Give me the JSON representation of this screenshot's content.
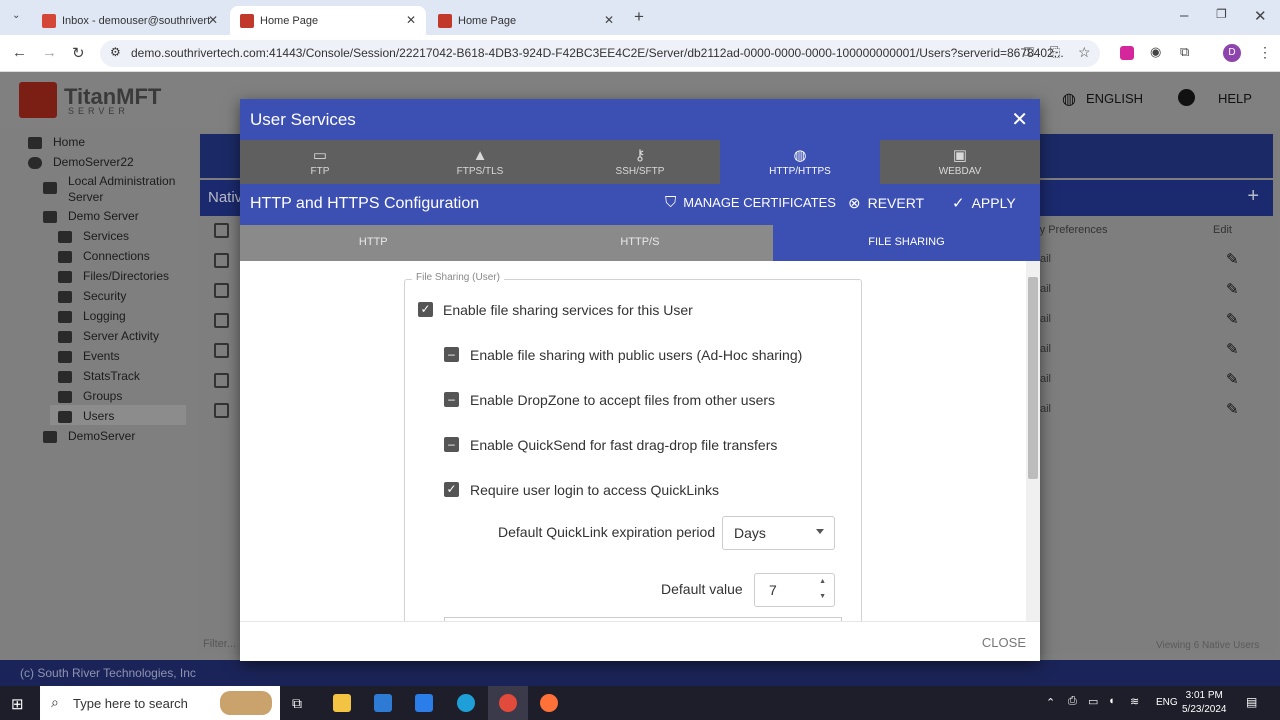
{
  "browser": {
    "tabs": [
      {
        "title": "Inbox - demouser@southrivert"
      },
      {
        "title": "Home Page"
      },
      {
        "title": "Home Page"
      }
    ],
    "url": "demo.southrivertech.com:41443/Console/Session/22217042-B618-4DB3-924D-F42BC3EE4C2E/Server/db2112ad-0000-0000-0000-100000000001/Users?serverid=8678402..."
  },
  "app": {
    "logo_text": "TitanMFT",
    "logo_sub": "SERVER",
    "language": "ENGLISH",
    "help": "HELP",
    "sidebar": [
      {
        "label": "Home"
      },
      {
        "label": "DemoServer22"
      },
      {
        "label": "Local Administration Server"
      },
      {
        "label": "Demo Server"
      },
      {
        "label": "Services"
      },
      {
        "label": "Connections"
      },
      {
        "label": "Files/Directories"
      },
      {
        "label": "Security"
      },
      {
        "label": "Logging"
      },
      {
        "label": "Server Activity"
      },
      {
        "label": "Events"
      },
      {
        "label": "StatsTrack"
      },
      {
        "label": "Groups"
      },
      {
        "label": "Users"
      },
      {
        "label": "DemoServer"
      }
    ],
    "background_table": {
      "title": "Nativ",
      "col_prefs": "ry Preferences",
      "col_edit": "Edit",
      "row_cell": "ail",
      "filter": "Filter...",
      "viewing": "Viewing 6 Native Users"
    },
    "footer": "(c) South River Technologies, Inc"
  },
  "modal": {
    "title": "User Services",
    "protocol_tabs": [
      {
        "label": "FTP"
      },
      {
        "label": "FTPS/TLS"
      },
      {
        "label": "SSH/SFTP"
      },
      {
        "label": "HTTP/HTTPS"
      },
      {
        "label": "WEBDAV"
      }
    ],
    "config_title": "HTTP and HTTPS Configuration",
    "manage_certificates": "MANAGE CERTIFICATES",
    "revert": "REVERT",
    "apply": "APPLY",
    "sub_tabs": [
      {
        "label": "HTTP"
      },
      {
        "label": "HTTP/S"
      },
      {
        "label": "FILE SHARING"
      }
    ],
    "fieldset_legend": "File Sharing (User)",
    "options": [
      {
        "label": "Enable file sharing services for this User",
        "state": "checked"
      },
      {
        "label": "Enable file sharing with public users (Ad-Hoc sharing)",
        "state": "indeterminate"
      },
      {
        "label": "Enable DropZone to accept files from other users",
        "state": "indeterminate"
      },
      {
        "label": "Enable QuickSend for fast drag-drop file transfers",
        "state": "indeterminate"
      },
      {
        "label": "Require user login to access QuickLinks",
        "state": "checked"
      }
    ],
    "expiration_label": "Default QuickLink expiration period",
    "expiration_value": "Days",
    "default_value_label": "Default value",
    "default_value": "7",
    "close": "CLOSE"
  },
  "taskbar": {
    "search_placeholder": "Type here to search",
    "lang": "ENG",
    "time": "3:01 PM",
    "date": "5/23/2024"
  }
}
